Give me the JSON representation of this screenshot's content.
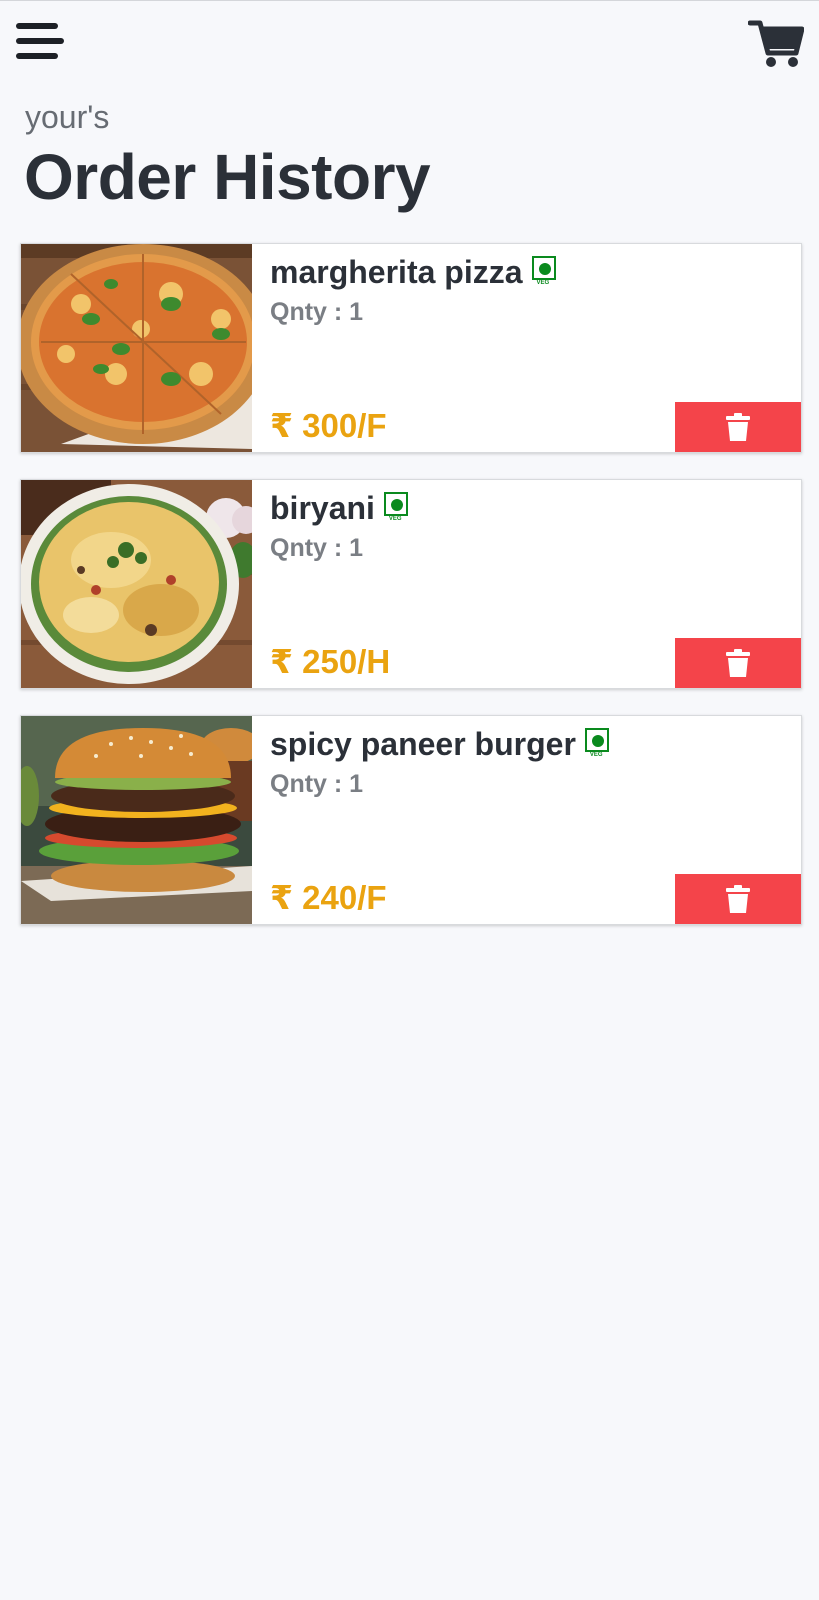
{
  "header": {
    "menu_icon": "hamburger-menu-icon",
    "cart_icon": "shopping-cart-icon",
    "subtitle": "your's",
    "title": "Order History"
  },
  "orders": [
    {
      "name": "margherita pizza",
      "veg_label": "VEG",
      "qty": "Qnty : 1",
      "price": "₹ 300/F",
      "image": "pizza"
    },
    {
      "name": "biryani",
      "veg_label": "VEG",
      "qty": "Qnty : 1",
      "price": "₹ 250/H",
      "image": "biryani"
    },
    {
      "name": "spicy paneer burger",
      "veg_label": "VEG",
      "qty": "Qnty : 1",
      "price": "₹ 240/F",
      "image": "burger"
    }
  ],
  "colors": {
    "background": "#f7f8fb",
    "price": "#eaa310",
    "delete_button": "#f4444a",
    "veg_green": "#0a8a1e",
    "title": "#2b3038"
  }
}
